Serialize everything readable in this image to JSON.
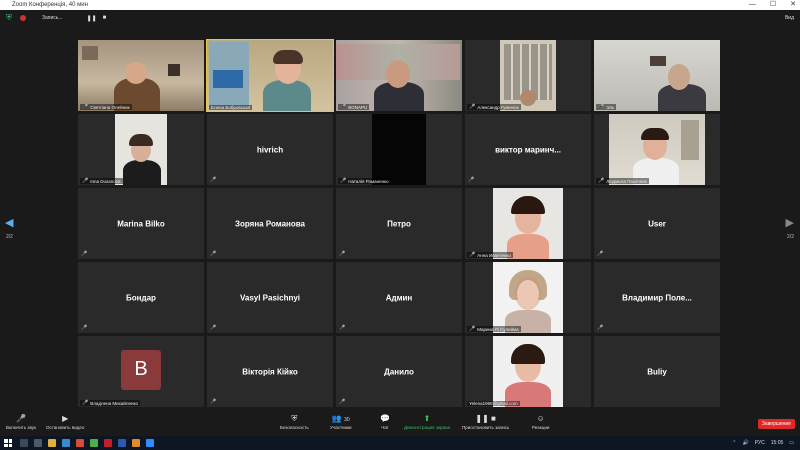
{
  "window": {
    "title": "Zoom Конференція, 40 мин",
    "minimize": "—",
    "maximize": "☐",
    "close": "✕"
  },
  "topbar": {
    "status": "Запись...",
    "view_label": "Вид"
  },
  "pager": {
    "left_page": "2/2",
    "right_page": "2/2"
  },
  "participants": [
    {
      "name": "Светлана Олейник",
      "kind": "video"
    },
    {
      "name": "Елена Бобровская",
      "kind": "video",
      "active": true
    },
    {
      "name": "BONAPU",
      "kind": "video"
    },
    {
      "name": "Александр Гуменюк",
      "kind": "video"
    },
    {
      "name": "Эль",
      "kind": "video"
    },
    {
      "name": "Inna Dusanova",
      "kind": "video"
    },
    {
      "name": "hivrich",
      "kind": "name"
    },
    {
      "name": "Наталія Романенко",
      "kind": "video"
    },
    {
      "name": "виктор маринч...",
      "kind": "name"
    },
    {
      "name": "Людмила Пасечник",
      "kind": "video"
    },
    {
      "name": "Marina Bilko",
      "kind": "name"
    },
    {
      "name": "Зоряна Романова",
      "kind": "name"
    },
    {
      "name": "Петро",
      "kind": "name"
    },
    {
      "name": "Анна Ивантенко",
      "kind": "video"
    },
    {
      "name": "User",
      "kind": "name"
    },
    {
      "name": "Бондар",
      "kind": "name"
    },
    {
      "name": "Vasyl Pasichnyi",
      "kind": "name"
    },
    {
      "name": "Админ",
      "kind": "name"
    },
    {
      "name": "Марина Лі Сулейма",
      "kind": "video"
    },
    {
      "name": "Владимир Поле...",
      "kind": "name"
    },
    {
      "name": "Владлена Михайленко",
      "kind": "avatar",
      "avatar_letter": "B"
    },
    {
      "name": "Вікторія Кійко",
      "kind": "name"
    },
    {
      "name": "Данило",
      "kind": "name"
    },
    {
      "name": "Yelena1968@gmail.com",
      "kind": "video"
    },
    {
      "name": "Buliy",
      "kind": "name"
    }
  ],
  "toolbar": {
    "unmute": "Включить звук",
    "stop_video": "Остановить видео",
    "security": "Безопасность",
    "participants": "Участники",
    "participants_count": "30",
    "chat": "Чат",
    "share": "Демонстрация экрана",
    "pause_share": "Приостановить запись",
    "reactions": "Реакции",
    "end": "Завершение"
  },
  "taskbar": {
    "lang": "РУС",
    "time": "15:05"
  },
  "colors": {
    "accent_green": "#3dbd5a",
    "end_red": "#e02828",
    "active_border": "#e8c448",
    "mic_red": "#e03b3b"
  }
}
